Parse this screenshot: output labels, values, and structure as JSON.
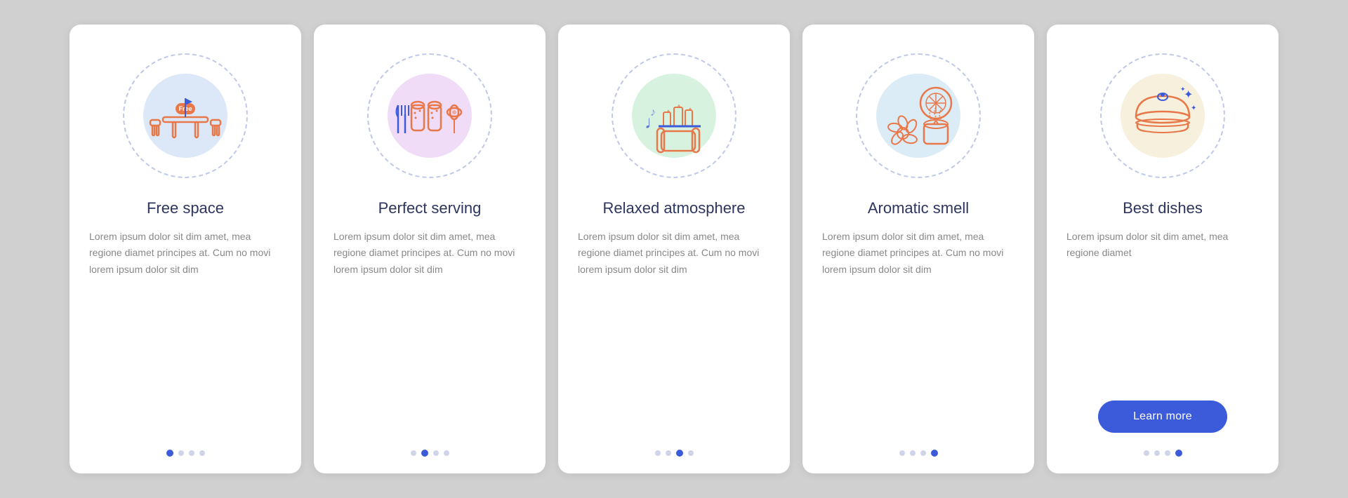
{
  "cards": [
    {
      "id": "free-space",
      "title": "Free space",
      "text": "Lorem ipsum dolor sit dim amet, mea regione diamet principes at. Cum no movi lorem ipsum dolor sit dim",
      "activeDot": 0,
      "totalDots": 4,
      "bgColor": "#dce8f7",
      "showButton": false
    },
    {
      "id": "perfect-serving",
      "title": "Perfect serving",
      "text": "Lorem ipsum dolor sit dim amet, mea regione diamet principes at. Cum no movi lorem ipsum dolor sit dim",
      "activeDot": 1,
      "totalDots": 4,
      "bgColor": "#f0dcf7",
      "showButton": false
    },
    {
      "id": "relaxed-atmosphere",
      "title": "Relaxed atmosphere",
      "text": "Lorem ipsum dolor sit dim amet, mea regione diamet principes at. Cum no movi lorem ipsum dolor sit dim",
      "activeDot": 2,
      "totalDots": 4,
      "bgColor": "#d8f2e0",
      "showButton": false
    },
    {
      "id": "aromatic-smell",
      "title": "Aromatic smell",
      "text": "Lorem ipsum dolor sit dim amet, mea regione diamet principes at. Cum no movi lorem ipsum dolor sit dim",
      "activeDot": 3,
      "totalDots": 4,
      "bgColor": "#dcecf7",
      "showButton": false
    },
    {
      "id": "best-dishes",
      "title": "Best dishes",
      "text": "Lorem ipsum dolor sit dim amet, mea regione diamet",
      "activeDot": 3,
      "totalDots": 4,
      "bgColor": "#f7f0dc",
      "showButton": true,
      "buttonLabel": "Learn more"
    }
  ]
}
